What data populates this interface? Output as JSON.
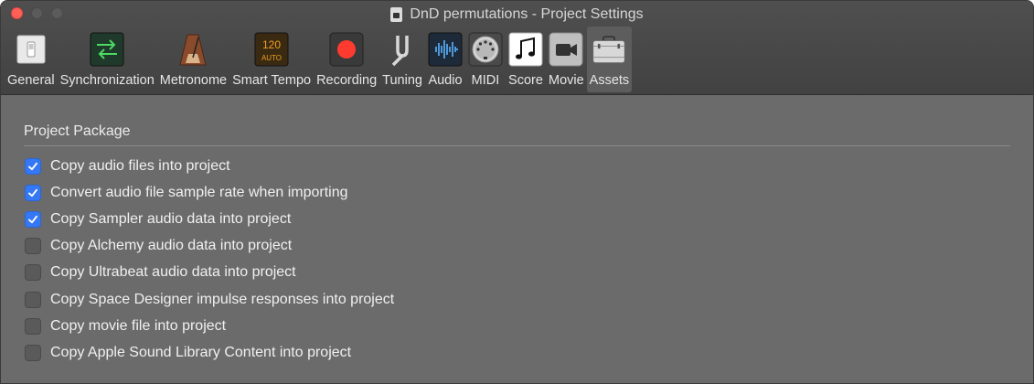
{
  "window": {
    "title": "DnD permutations - Project Settings"
  },
  "toolbar": {
    "items": [
      {
        "label": "General",
        "icon": "switch-icon"
      },
      {
        "label": "Synchronization",
        "icon": "sync-arrows-icon"
      },
      {
        "label": "Metronome",
        "icon": "metronome-icon"
      },
      {
        "label": "Smart Tempo",
        "icon": "tempo-display-icon",
        "display_top": "120",
        "display_bottom": "AUTO"
      },
      {
        "label": "Recording",
        "icon": "record-icon"
      },
      {
        "label": "Tuning",
        "icon": "tuning-fork-icon"
      },
      {
        "label": "Audio",
        "icon": "waveform-icon"
      },
      {
        "label": "MIDI",
        "icon": "midi-port-icon"
      },
      {
        "label": "Score",
        "icon": "music-note-icon"
      },
      {
        "label": "Movie",
        "icon": "camera-icon"
      },
      {
        "label": "Assets",
        "icon": "briefcase-icon",
        "active": true
      }
    ]
  },
  "project_package": {
    "title": "Project Package",
    "options": [
      {
        "label": "Copy audio files into project",
        "checked": true
      },
      {
        "label": "Convert audio file sample rate when importing",
        "checked": true
      },
      {
        "label": "Copy Sampler audio data into project",
        "checked": true
      },
      {
        "label": "Copy Alchemy audio data into project",
        "checked": false
      },
      {
        "label": "Copy Ultrabeat audio data into project",
        "checked": false
      },
      {
        "label": "Copy Space Designer impulse responses into project",
        "checked": false
      },
      {
        "label": "Copy movie file into project",
        "checked": false
      },
      {
        "label": "Copy Apple Sound Library Content into project",
        "checked": false
      }
    ]
  },
  "colors": {
    "accent": "#3478f6",
    "record": "#ff3b30",
    "window_bg": "#6b6b6b"
  }
}
